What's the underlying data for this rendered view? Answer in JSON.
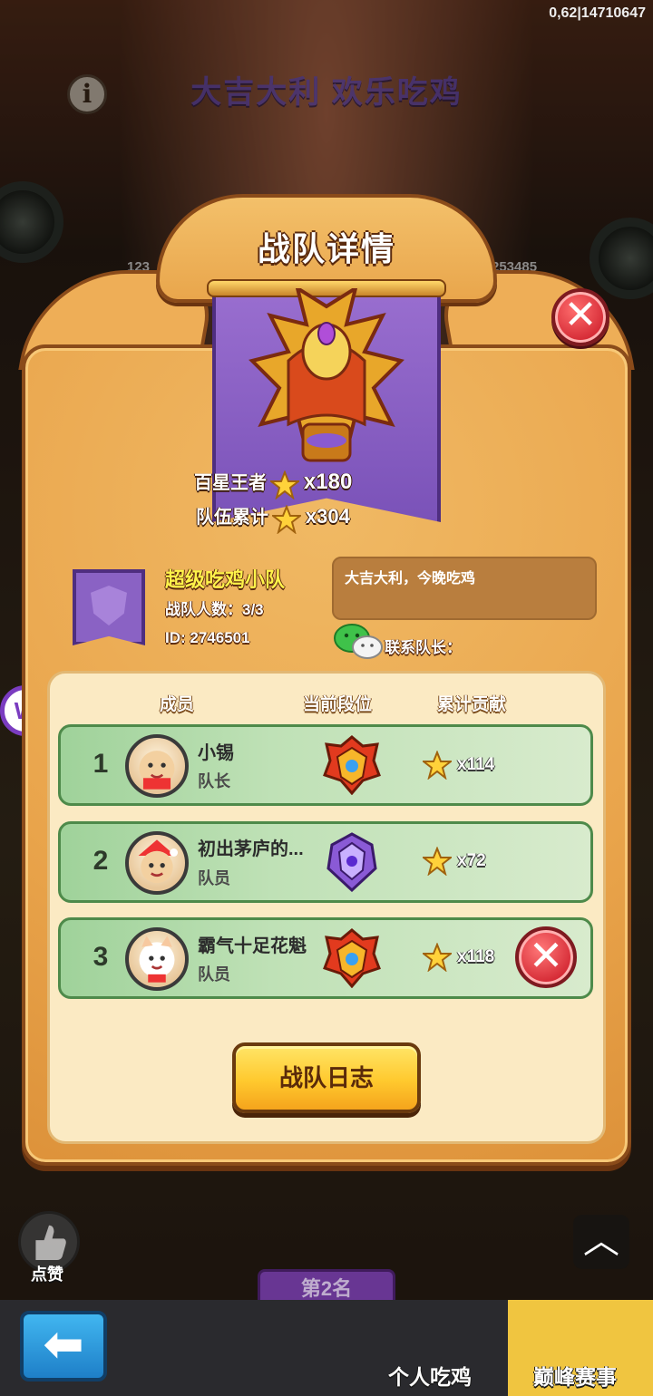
{
  "corner_code": "0,62|14710647",
  "background": {
    "banner_title": "大吉大利 欢乐吃鸡",
    "left_score": "123",
    "right_score": "253485",
    "rank_label": "第2名"
  },
  "dialog": {
    "title": "战队详情",
    "close_icon": "close-icon",
    "stats": {
      "king_label": "百星王者",
      "king_value": "x180",
      "total_label": "队伍累计",
      "total_value": "x304"
    },
    "team": {
      "name": "超级吃鸡小队",
      "member_count": "战队人数：3/3",
      "id": "ID: 2746501",
      "slogan": "大吉大利，今晚吃鸡",
      "contact_label": "联系队长："
    },
    "table": {
      "headers": [
        "成员",
        "当前段位",
        "累计贡献"
      ],
      "rows": [
        {
          "rank": "1",
          "name": "小锡",
          "role": "队长",
          "contribution": "x114",
          "badge": "red-gold"
        },
        {
          "rank": "2",
          "name": "初出茅庐的...",
          "role": "队员",
          "contribution": "x72",
          "badge": "purple"
        },
        {
          "rank": "3",
          "name": "霸气十足花魁",
          "role": "队员",
          "contribution": "x118",
          "badge": "red-gold"
        }
      ]
    },
    "log_button": "战队日志"
  },
  "bottom": {
    "like_label": "点赞",
    "tab_personal": "个人吃鸡",
    "tab_peak": "巅峰赛事"
  },
  "colors": {
    "panel": "#e9a44b",
    "flag": "#8a62c4",
    "row": "#bfe1b6",
    "close": "#d52a35",
    "button": "#ffc92e"
  }
}
